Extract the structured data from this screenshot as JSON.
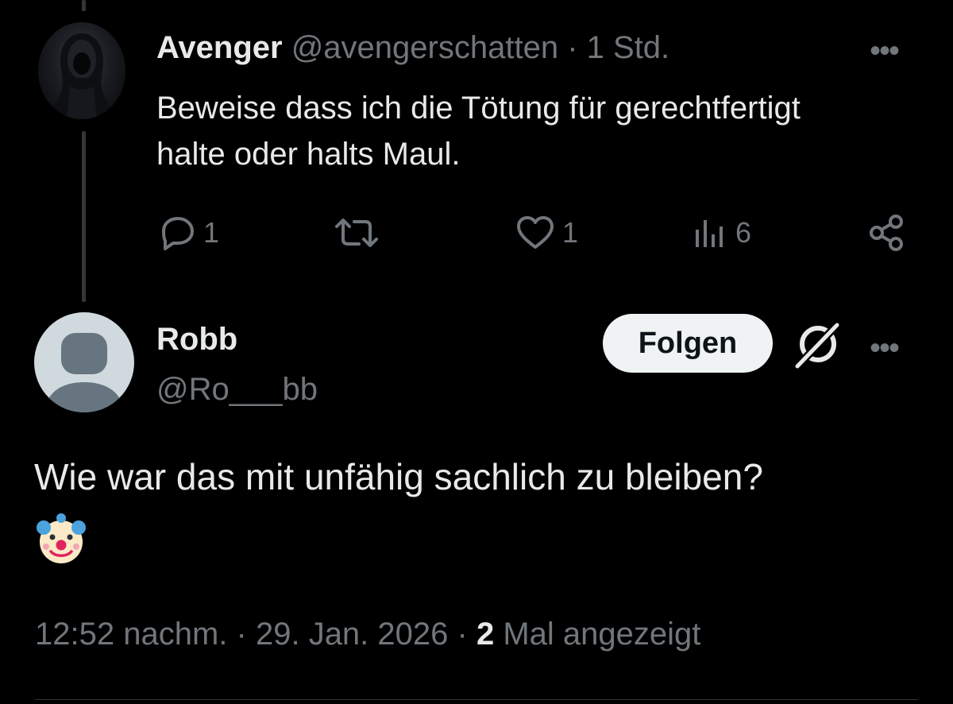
{
  "parent_tweet": {
    "author_name": "Avenger",
    "handle": "@avengerschatten",
    "separator": "·",
    "time": "1 Std.",
    "text": "Beweise dass ich die Tötung für gerechtfertigt halte oder halts Maul.",
    "more_label": "•••",
    "actions": {
      "replies": "1",
      "reposts": "",
      "likes": "1",
      "views": "6"
    }
  },
  "main_tweet": {
    "author_name": "Robb",
    "handle": "@Ro___bb",
    "follow_label": "Folgen",
    "more_label": "•••",
    "text": "Wie war das mit unfähig sachlich zu bleiben?",
    "emoji": "clown-face",
    "footer": {
      "time": "12:52 nachm.",
      "separator": "·",
      "date": "29. Jan. 2026",
      "view_count": "2",
      "view_label": "Mal angezeigt"
    }
  },
  "icons": [
    "hooded-figure-avatar",
    "default-avatar",
    "reply-icon",
    "repost-icon",
    "like-icon",
    "views-icon",
    "share-icon",
    "grok-icon",
    "more-icon",
    "clown-emoji"
  ],
  "colors": {
    "background": "#000000",
    "text_primary": "#e7e9ea",
    "text_secondary": "#71767b",
    "thread_line": "#333639",
    "follow_button_bg": "#eff3f4",
    "follow_button_text": "#0f1419",
    "default_avatar_bg": "#cfd9de",
    "default_avatar_fg": "#66757f"
  }
}
